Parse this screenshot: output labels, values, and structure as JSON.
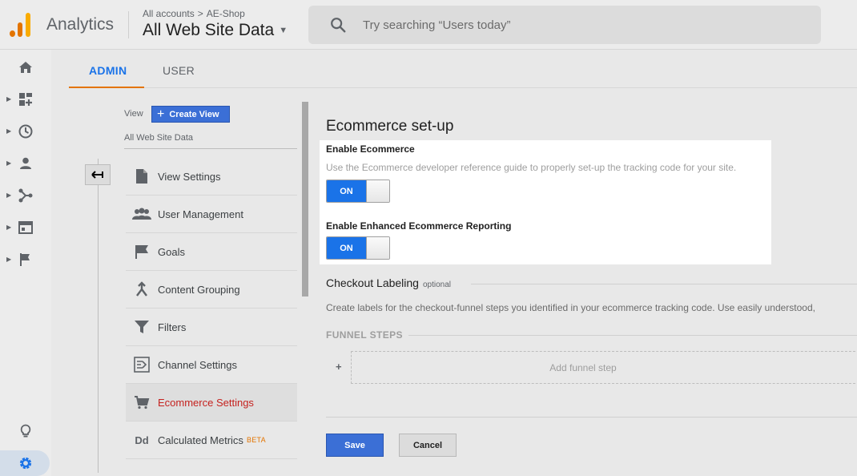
{
  "header": {
    "app_title": "Analytics",
    "breadcrumb": [
      "All accounts",
      "AE-Shop"
    ],
    "breadcrumb_separator": ">",
    "property": "All Web Site Data",
    "search_placeholder": "Try searching “Users today”"
  },
  "rail": {
    "icons": [
      "home-icon",
      "dashboard-icon",
      "clock-icon",
      "person-icon",
      "acquisition-icon",
      "behavior-icon",
      "flag-icon",
      "lightbulb-icon",
      "gear-icon"
    ],
    "active": "gear-icon"
  },
  "tabs": [
    {
      "label": "ADMIN",
      "active": true
    },
    {
      "label": "USER",
      "active": false
    }
  ],
  "view_column": {
    "label": "View",
    "create_button": "Create View",
    "view_name": "All Web Site Data",
    "items": [
      {
        "label": "View Settings",
        "icon": "document-icon"
      },
      {
        "label": "User Management",
        "icon": "people-icon"
      },
      {
        "label": "Goals",
        "icon": "flag-icon"
      },
      {
        "label": "Content Grouping",
        "icon": "content-grouping-icon"
      },
      {
        "label": "Filters",
        "icon": "filter-icon"
      },
      {
        "label": "Channel Settings",
        "icon": "channel-icon"
      },
      {
        "label": "Ecommerce Settings",
        "icon": "cart-icon",
        "active": true
      },
      {
        "label": "Calculated Metrics",
        "icon": "dd-icon",
        "badge": "BETA"
      }
    ]
  },
  "main": {
    "title": "Ecommerce set-up",
    "enable_ecommerce": {
      "label": "Enable Ecommerce",
      "description": "Use the Ecommerce developer reference guide to properly set-up the tracking code for your site.",
      "toggle": "ON"
    },
    "enhanced": {
      "label": "Enable Enhanced Ecommerce Reporting",
      "toggle": "ON"
    },
    "checkout": {
      "title": "Checkout Labeling",
      "optional": "optional",
      "description": "Create labels for the checkout-funnel steps you identified in your ecommerce tracking code. Use easily understood,"
    },
    "funnel": {
      "label": "FUNNEL STEPS",
      "add_plus": "+",
      "add_step": "Add funnel step"
    },
    "save": "Save",
    "cancel": "Cancel"
  },
  "colors": {
    "accent_blue": "#1a73e8",
    "button_blue": "#3b6fd6",
    "active_red": "#c5221f",
    "tab_underline": "#e37400"
  }
}
